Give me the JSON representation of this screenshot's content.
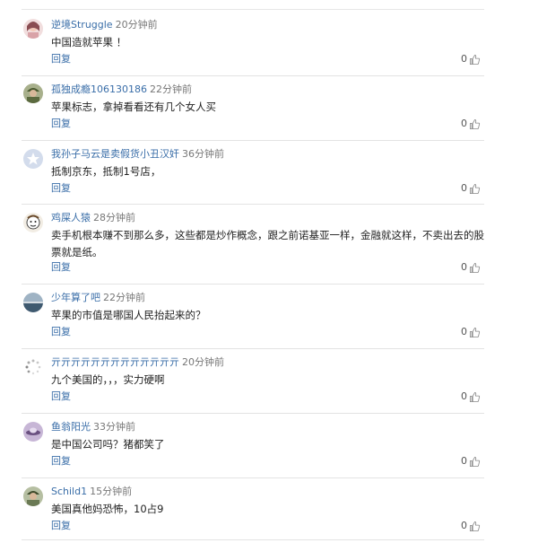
{
  "comments": [
    {
      "username": "逆境Struggle",
      "time": "20分钟前",
      "text": "中国造就苹果 ！",
      "reply_label": "回复",
      "likes": "0",
      "avatar_icon": "avatar-pink-girl-icon",
      "avatar_color": "#d9a3a8"
    },
    {
      "username": "孤独成瘾106130186",
      "time": "22分钟前",
      "text": "苹果标志，拿掉看看还有几个女人买",
      "reply_label": "回复",
      "likes": "0",
      "avatar_icon": "avatar-soldier-icon",
      "avatar_color": "#5b6a3f"
    },
    {
      "username": "我孙子马云是卖假货小丑汉奸",
      "time": "36分钟前",
      "text": "抵制京东，抵制1号店，",
      "reply_label": "回复",
      "likes": "0",
      "avatar_icon": "avatar-default-star-icon",
      "avatar_color": "#b9c7e0"
    },
    {
      "username": "鸡屎人猿",
      "time": "28分钟前",
      "text": "卖手机根本赚不到那么多，这些都是炒作概念，跟之前诺基亚一样，金融就这样，不卖出去的股票就是纸。",
      "reply_label": "回复",
      "likes": "0",
      "avatar_icon": "avatar-cartoon-face-icon",
      "avatar_color": "#e8e0d0"
    },
    {
      "username": "少年算了吧",
      "time": "22分钟前",
      "text": "苹果的市值是哪国人民抬起来的？",
      "reply_label": "回复",
      "likes": "0",
      "avatar_icon": "avatar-sea-landscape-icon",
      "avatar_color": "#6f8aa0"
    },
    {
      "username": "亓亓亓亓亓亓亓亓亓亓亓亓亓",
      "time": "20分钟前",
      "text": "九个美国的，，，实力硬啊",
      "reply_label": "回复",
      "likes": "0",
      "avatar_icon": "avatar-loading-spinner-icon",
      "avatar_color": "#cccccc"
    },
    {
      "username": "鱼翁阳光",
      "time": "33分钟前",
      "text": "是中国公司吗？猪都笑了",
      "reply_label": "回复",
      "likes": "0",
      "avatar_icon": "avatar-ufo-icon",
      "avatar_color": "#9b7fb0"
    },
    {
      "username": "Schild1",
      "time": "15分钟前",
      "text": "美国真他妈恐怖，10占9",
      "reply_label": "回复",
      "likes": "0",
      "avatar_icon": "avatar-soldier-icon",
      "avatar_color": "#6b7a55"
    }
  ]
}
